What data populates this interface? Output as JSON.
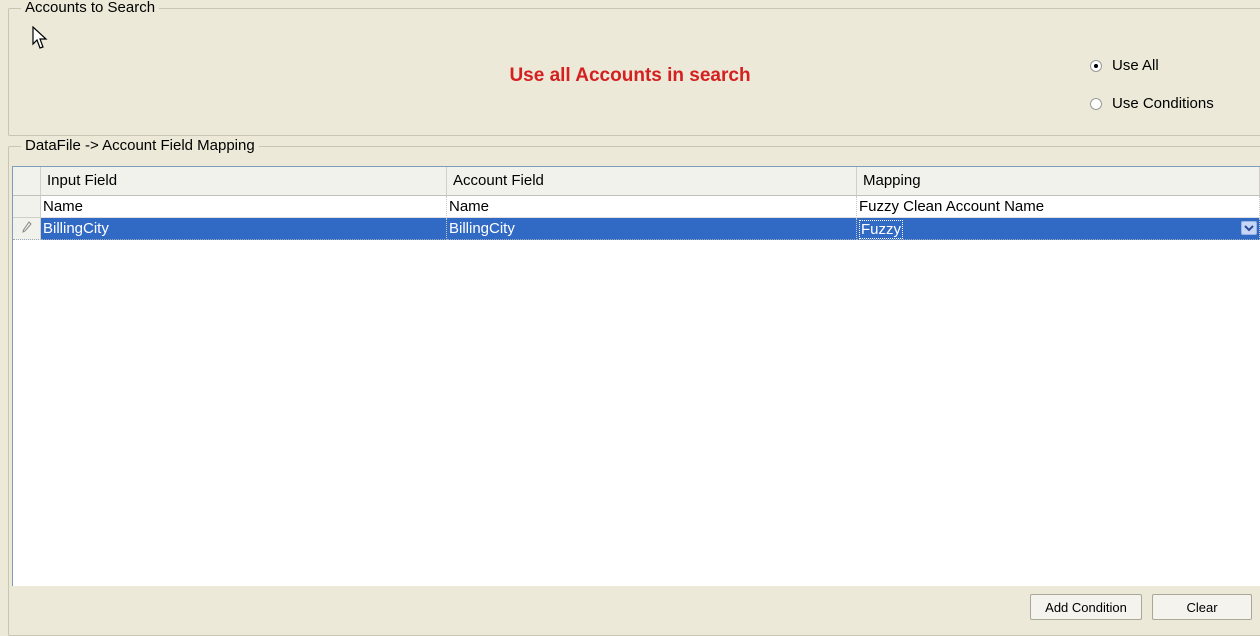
{
  "accounts_group": {
    "legend": "Accounts to Search",
    "banner": "Use all Accounts in search",
    "options": [
      {
        "label": "Use All",
        "selected": true
      },
      {
        "label": "Use Conditions",
        "selected": false
      }
    ]
  },
  "mapping_group": {
    "legend": "DataFile -> Account Field Mapping",
    "columns": [
      "Input Field",
      "Account Field",
      "Mapping"
    ],
    "rows": [
      {
        "input": "Name",
        "account": "Name",
        "mapping": "Fuzzy Clean Account Name"
      },
      {
        "input": "BillingCity",
        "account": "BillingCity",
        "mapping": "Fuzzy"
      }
    ]
  },
  "buttons": {
    "add_condition": "Add Condition",
    "clear": "Clear"
  },
  "colors": {
    "banner_text": "#d42020",
    "selection": "#316ac5",
    "form_background": "#ece9d8"
  },
  "icons": {
    "cursor": "mouse-pointer-icon",
    "edit_row": "pencil-icon",
    "dropdown": "chevron-down-icon"
  }
}
